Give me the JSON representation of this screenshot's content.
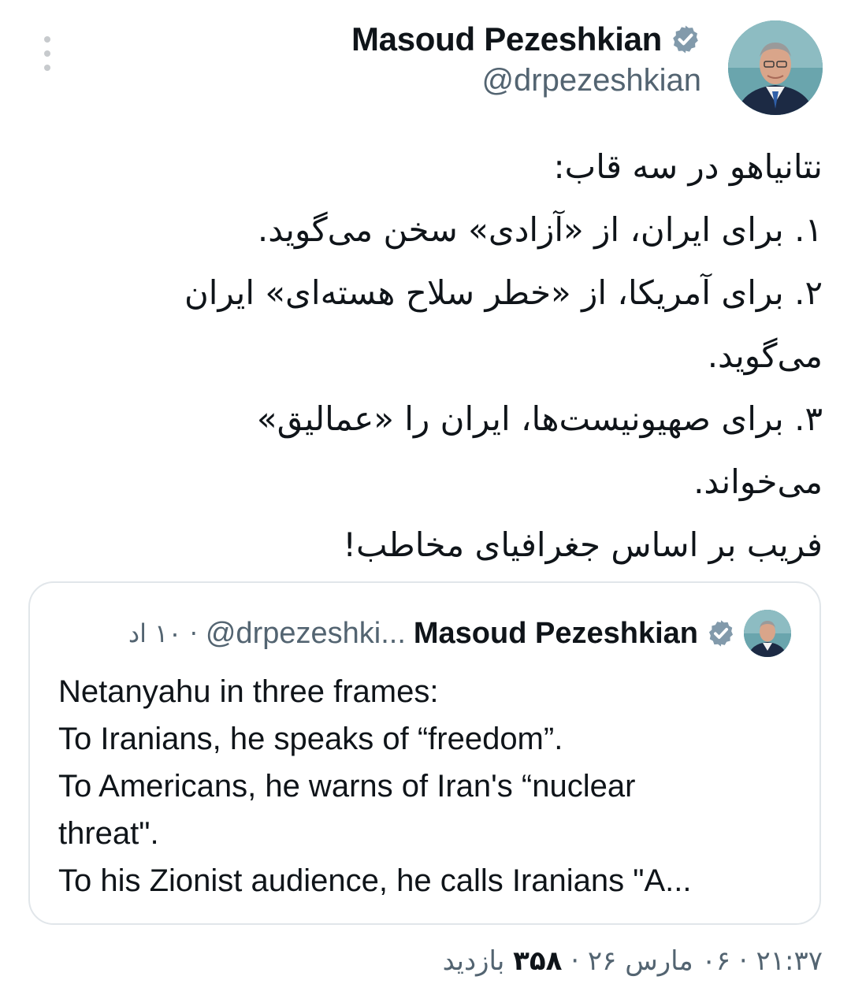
{
  "author": {
    "name": "Masoud Pezeshkian",
    "handle": "@drpezeshkian"
  },
  "tweet": {
    "lines": [
      "نتانیاهو در سه قاب:",
      "۱. برای ایران، از «آزادی» سخن می‌گوید.",
      "۲. برای آمریکا، از «خطر سلاح هسته‌ای» ایران",
      "می‌گوید.",
      "۳. برای صهیونیست‌ها، ایران را «عمالیق»",
      "می‌خواند.",
      "فریب بر اساس جغرافیای مخاطب!"
    ]
  },
  "quote": {
    "name": "Masoud Pezeshkian",
    "handle": "@drpezeshki...",
    "time": "· ۱۰ اد",
    "lines": [
      "Netanyahu in three frames:",
      "To Iranians, he speaks of “freedom”.",
      "To Americans, he warns of Iran's “nuclear",
      "threat\".",
      "To his Zionist audience, he calls Iranians \"A..."
    ]
  },
  "meta": {
    "timestamp": "۲۱:۳۷ · ۰۶ مارس ۲۶ · ",
    "views_count": "۳۵۸",
    "views_label": " بازدید"
  },
  "colors": {
    "verified": "#829aab",
    "secondary_text": "#536471",
    "primary_text": "#0f1419",
    "border": "#e1e6ea"
  },
  "icons": {
    "more": "vertical-ellipsis-icon",
    "verified": "verified-badge-icon"
  }
}
